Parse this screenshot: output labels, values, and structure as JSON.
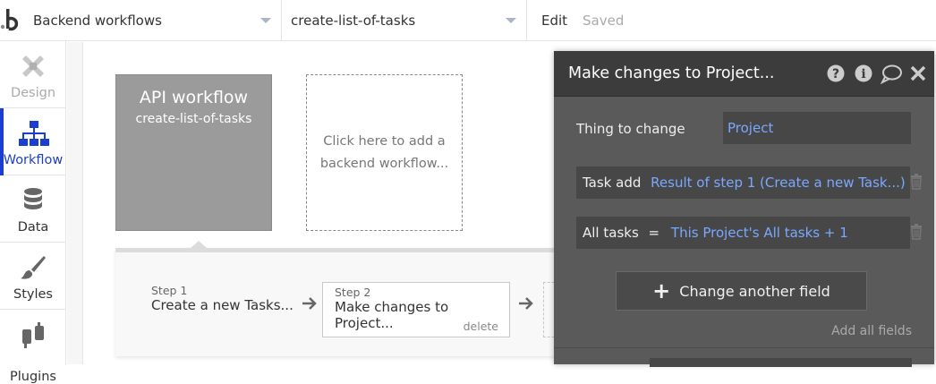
{
  "topbar": {
    "page_select": "Backend workflows",
    "workflow_select": "create-list-of-tasks",
    "edit_label": "Edit",
    "saved_label": "Saved"
  },
  "sidebar": {
    "items": [
      {
        "label": "Design",
        "icon": "design-icon"
      },
      {
        "label": "Workflow",
        "icon": "workflow-icon",
        "active": true
      },
      {
        "label": "Data",
        "icon": "database-icon"
      },
      {
        "label": "Styles",
        "icon": "brush-icon"
      },
      {
        "label": "Plugins",
        "icon": "plug-icon"
      }
    ]
  },
  "canvas": {
    "api_card": {
      "title": "API workflow",
      "subtitle": "create-list-of-tasks"
    },
    "add_card": {
      "text": "Click here to add a backend workflow..."
    }
  },
  "steps": [
    {
      "number": "Step 1",
      "label": "Create a new Tasks..."
    },
    {
      "number": "Step 2",
      "label": "Make changes to Project...",
      "delete_label": "delete"
    }
  ],
  "editor": {
    "title": "Make changes to Project...",
    "thing_label": "Thing to change",
    "thing_value": "Project",
    "fields": [
      {
        "name": "Task add",
        "op": "",
        "value": "Result of step 1 (Create a new Task...)"
      },
      {
        "name": "All tasks",
        "op": "=",
        "value": "This Project's All tasks + 1"
      }
    ],
    "change_button": "Change another field",
    "add_all": "Add all fields"
  },
  "colors": {
    "accent": "#1a3fd0",
    "link_blue": "#7aa8ff",
    "panel_dark": "#5a5a5a",
    "header_dark": "#3c3c3c"
  }
}
